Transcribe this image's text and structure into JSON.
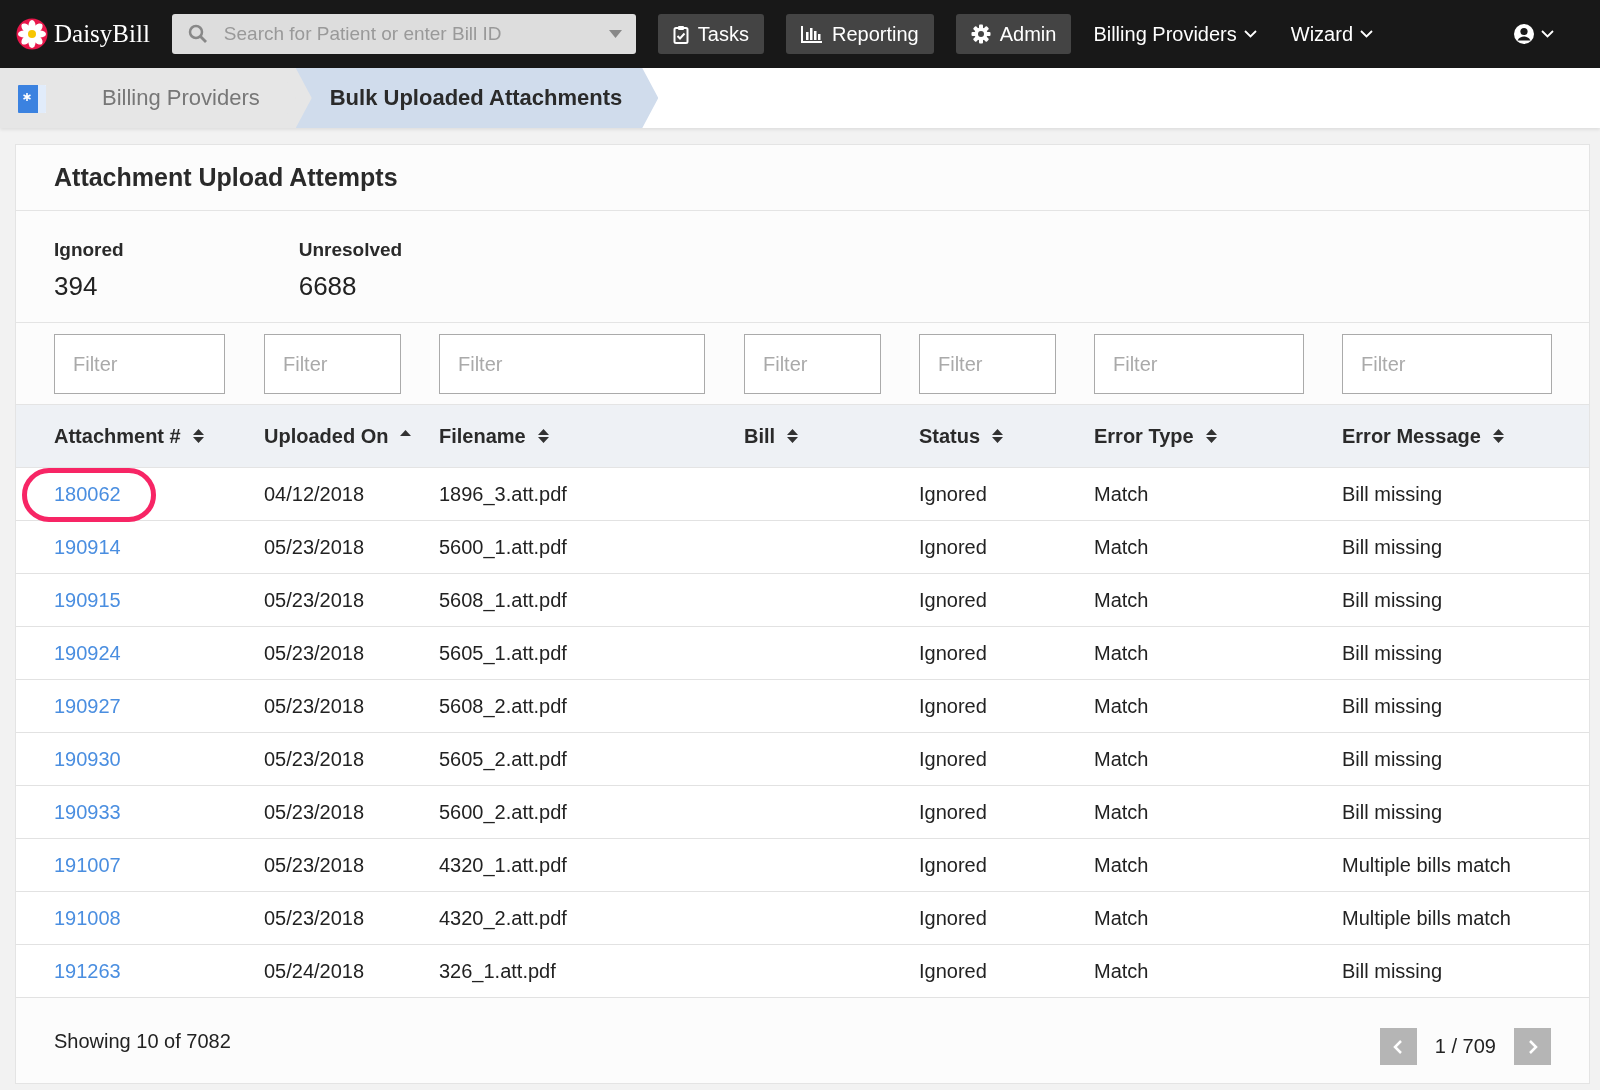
{
  "header": {
    "brand": "DaisyBill",
    "search": {
      "placeholder": "Search for Patient or enter Bill ID"
    },
    "nav": [
      {
        "kind": "button",
        "label": "Tasks"
      },
      {
        "kind": "button",
        "label": "Reporting"
      },
      {
        "kind": "button",
        "label": "Admin"
      },
      {
        "kind": "menu",
        "label": "Billing Providers"
      },
      {
        "kind": "menu",
        "label": "Wizard"
      }
    ]
  },
  "breadcrumb": [
    {
      "label": "Billing Providers",
      "selected": false
    },
    {
      "label": "Bulk Uploaded Attachments",
      "selected": true
    }
  ],
  "card": {
    "title": "Attachment Upload Attempts",
    "stats": [
      {
        "label": "Ignored",
        "value": "394"
      },
      {
        "label": "Unresolved",
        "value": "6688"
      }
    ],
    "table": {
      "columns": [
        {
          "label": "Attachment #",
          "sorted": false,
          "placeholder": "Filter"
        },
        {
          "label": "Uploaded On",
          "sorted": true,
          "placeholder": "Filter"
        },
        {
          "label": "Filename",
          "sorted": false,
          "placeholder": "Filter"
        },
        {
          "label": "Bill",
          "sorted": false,
          "placeholder": "Filter"
        },
        {
          "label": "Status",
          "sorted": false,
          "placeholder": "Filter"
        },
        {
          "label": "Error Type",
          "sorted": false,
          "placeholder": "Filter"
        },
        {
          "label": "Error Message",
          "sorted": false,
          "placeholder": "Filter"
        }
      ],
      "rows": [
        {
          "highlighted": true,
          "cells": [
            "180062",
            "04/12/2018",
            "1896_3.att.pdf",
            "",
            "Ignored",
            "Match",
            "Bill missing"
          ]
        },
        {
          "highlighted": false,
          "cells": [
            "190914",
            "05/23/2018",
            "5600_1.att.pdf",
            "",
            "Ignored",
            "Match",
            "Bill missing"
          ]
        },
        {
          "highlighted": false,
          "cells": [
            "190915",
            "05/23/2018",
            "5608_1.att.pdf",
            "",
            "Ignored",
            "Match",
            "Bill missing"
          ]
        },
        {
          "highlighted": false,
          "cells": [
            "190924",
            "05/23/2018",
            "5605_1.att.pdf",
            "",
            "Ignored",
            "Match",
            "Bill missing"
          ]
        },
        {
          "highlighted": false,
          "cells": [
            "190927",
            "05/23/2018",
            "5608_2.att.pdf",
            "",
            "Ignored",
            "Match",
            "Bill missing"
          ]
        },
        {
          "highlighted": false,
          "cells": [
            "190930",
            "05/23/2018",
            "5605_2.att.pdf",
            "",
            "Ignored",
            "Match",
            "Bill missing"
          ]
        },
        {
          "highlighted": false,
          "cells": [
            "190933",
            "05/23/2018",
            "5600_2.att.pdf",
            "",
            "Ignored",
            "Match",
            "Bill missing"
          ]
        },
        {
          "highlighted": false,
          "cells": [
            "191007",
            "05/23/2018",
            "4320_1.att.pdf",
            "",
            "Ignored",
            "Match",
            "Multiple bills match"
          ]
        },
        {
          "highlighted": false,
          "cells": [
            "191008",
            "05/23/2018",
            "4320_2.att.pdf",
            "",
            "Ignored",
            "Match",
            "Multiple bills match"
          ]
        },
        {
          "highlighted": false,
          "cells": [
            "191263",
            "05/24/2018",
            "326_1.att.pdf",
            "",
            "Ignored",
            "Match",
            "Bill missing"
          ]
        }
      ]
    },
    "footer": {
      "showing": "Showing 10 of 7082",
      "page": "1 / 709"
    }
  }
}
